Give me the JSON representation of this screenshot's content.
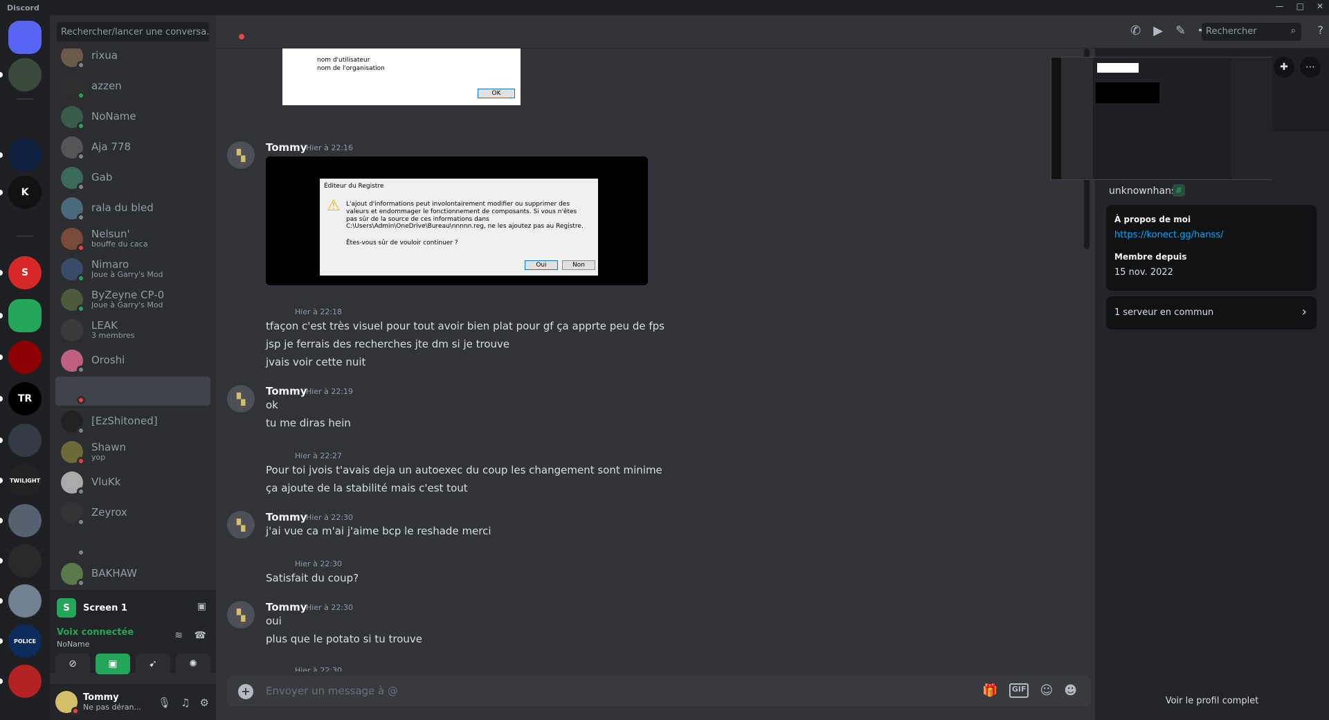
{
  "app": {
    "title": "Discord",
    "window_controls": [
      "—",
      "□",
      "✕"
    ]
  },
  "guilds": [
    {
      "label": "",
      "color": "#5865f2"
    },
    {
      "label": "",
      "color": "#3a4a3a"
    },
    {
      "label": "",
      "color": "#102040"
    },
    {
      "label": "K",
      "color": "#111111"
    },
    {
      "label": "S",
      "color": "#d62828"
    },
    {
      "label": "",
      "color": "#23a55a"
    },
    {
      "label": "",
      "color": "#8b0000"
    },
    {
      "label": "TR",
      "color": "#000000"
    },
    {
      "label": "",
      "color": "#333a44"
    },
    {
      "label": "TWILIGHT",
      "color": "#222222"
    },
    {
      "label": "",
      "color": "#556070"
    },
    {
      "label": "",
      "color": "#2a2a2a"
    },
    {
      "label": "",
      "color": "#708090"
    },
    {
      "label": "POLICE",
      "color": "#0b2b5b"
    },
    {
      "label": "",
      "color": "#b22222"
    },
    {
      "label": "",
      "color": "#7f8ad0"
    }
  ],
  "sidebar": {
    "search_placeholder": "Rechercher/lancer une conversa...",
    "dms": [
      {
        "name": "rixua",
        "sub": "",
        "status": "off",
        "color": "#6b5a4a"
      },
      {
        "name": "azzen",
        "sub": "",
        "status": "on",
        "color": "#2f2f2f"
      },
      {
        "name": "NoName",
        "sub": "",
        "status": "on",
        "color": "#3a5a4a"
      },
      {
        "name": "Aja 778",
        "sub": "",
        "status": "off",
        "color": "#555555"
      },
      {
        "name": "Gab",
        "sub": "",
        "status": "off",
        "color": "#3a6a5a"
      },
      {
        "name": "rala du bled",
        "sub": "",
        "status": "off",
        "color": "#4a6a7a"
      },
      {
        "name": "Nelsun'",
        "sub": "bouffe du caca",
        "status": "dnd",
        "color": "#7a4a3a"
      },
      {
        "name": "Nimaro",
        "sub": "Joue à Garry's Mod",
        "status": "on",
        "color": "#3a4a6a"
      },
      {
        "name": "ByZeyne CP-0",
        "sub": "Joue à Garry's Mod",
        "status": "on",
        "color": "#4a5a3a"
      },
      {
        "name": "LEAK",
        "sub": "3 membres",
        "status": "",
        "color": "#3a3a3a"
      },
      {
        "name": "Oroshi",
        "sub": "",
        "status": "off",
        "color": "#c06080"
      },
      {
        "name": "",
        "sub": "",
        "status": "dnd",
        "color": "#404249"
      },
      {
        "name": "[EzShitoned]",
        "sub": "",
        "status": "off",
        "color": "#222222"
      },
      {
        "name": "Shawn",
        "sub": "yop",
        "status": "dnd",
        "color": "#6a6a3a"
      },
      {
        "name": "VluKk",
        "sub": "",
        "status": "off",
        "color": "#aaaaaa"
      },
      {
        "name": "Zeyrox",
        "sub": "",
        "status": "off",
        "color": "#333333"
      },
      {
        "name": "",
        "sub": "",
        "status": "off",
        "color": "#2b2d31"
      },
      {
        "name": "BAKHAW",
        "sub": "",
        "status": "off",
        "color": "#5a7a4a"
      }
    ],
    "voice": {
      "screen_badge": "S",
      "screen_title": "Screen 1",
      "connected_label": "Voix connectée",
      "channel": "NoName"
    },
    "user": {
      "name": "Tommy",
      "status": "Ne pas déran..."
    }
  },
  "topbar": {
    "icons": [
      "phone-icon",
      "video-icon",
      "pin-icon",
      "add-friend-icon",
      "profile-icon"
    ],
    "search_placeholder": "Rechercher"
  },
  "chat": {
    "top_dialog": {
      "line1": "nom d'utilisateur",
      "line2": "nom de l'organisation",
      "ok": "OK"
    },
    "registry_dialog": {
      "title": "Éditeur du Registre",
      "message": "L'ajout d'informations peut involontairement modifier ou supprimer des valeurs et endommager le fonctionnement de composants. Si vous n'êtes pas sûr de la source de ces informations dans C:\\Users\\Admin\\OneDrive\\Bureau\\nnnnn.reg, ne les ajoutez pas au Registre.",
      "question": "Êtes-vous sûr de vouloir continuer ?",
      "yes": "Oui",
      "no": "Non"
    },
    "messages": [
      {
        "author": "Tommy",
        "time": "Hier à 22:16"
      },
      {
        "time": "Hier à 22:18",
        "lines": [
          "tfaçon c'est très visuel pour tout avoir bien plat pour gf ça apprte peu de fps",
          "jsp je ferrais des recherches jte dm si je trouve",
          "jvais voir cette nuit"
        ]
      },
      {
        "author": "Tommy",
        "time": "Hier à 22:19",
        "lines": [
          "ok",
          "tu me diras hein"
        ]
      },
      {
        "time": "Hier à 22:27",
        "lines": [
          "Pour toi jvois t'avais deja un autoexec du coup les changement sont minime",
          "ça ajoute de la stabilité mais c'est tout"
        ]
      },
      {
        "author": "Tommy",
        "time": "Hier à 22:30",
        "lines": [
          "j'ai vue ca m'ai j'aime bcp le reshade merci"
        ]
      },
      {
        "time": "Hier à 22:30",
        "lines": [
          "Satisfait du coup?"
        ]
      },
      {
        "author": "Tommy",
        "time": "Hier à 22:30",
        "lines": [
          "oui",
          "plus que le potato si tu trouve"
        ]
      },
      {
        "time": "Hier à 22:30",
        "lines": []
      }
    ],
    "input_placeholder": "Envoyer un message à @",
    "input_icons": [
      "gift-icon",
      "gif-icon",
      "sticker-icon",
      "emoji-icon"
    ],
    "gif_label": "GIF"
  },
  "profile": {
    "handle": "unknownhans.",
    "about_title": "À propos de moi",
    "about_link": "https://konect.gg/hanss/",
    "member_since_label": "Membre depuis",
    "member_since": "15 nov. 2022",
    "common": "1 serveur en commun",
    "full_profile": "Voir le profil complet"
  },
  "colors": {
    "accent": "#5865f2",
    "online": "#23a55a",
    "dnd": "#f23f43",
    "link": "#00a8fc"
  }
}
